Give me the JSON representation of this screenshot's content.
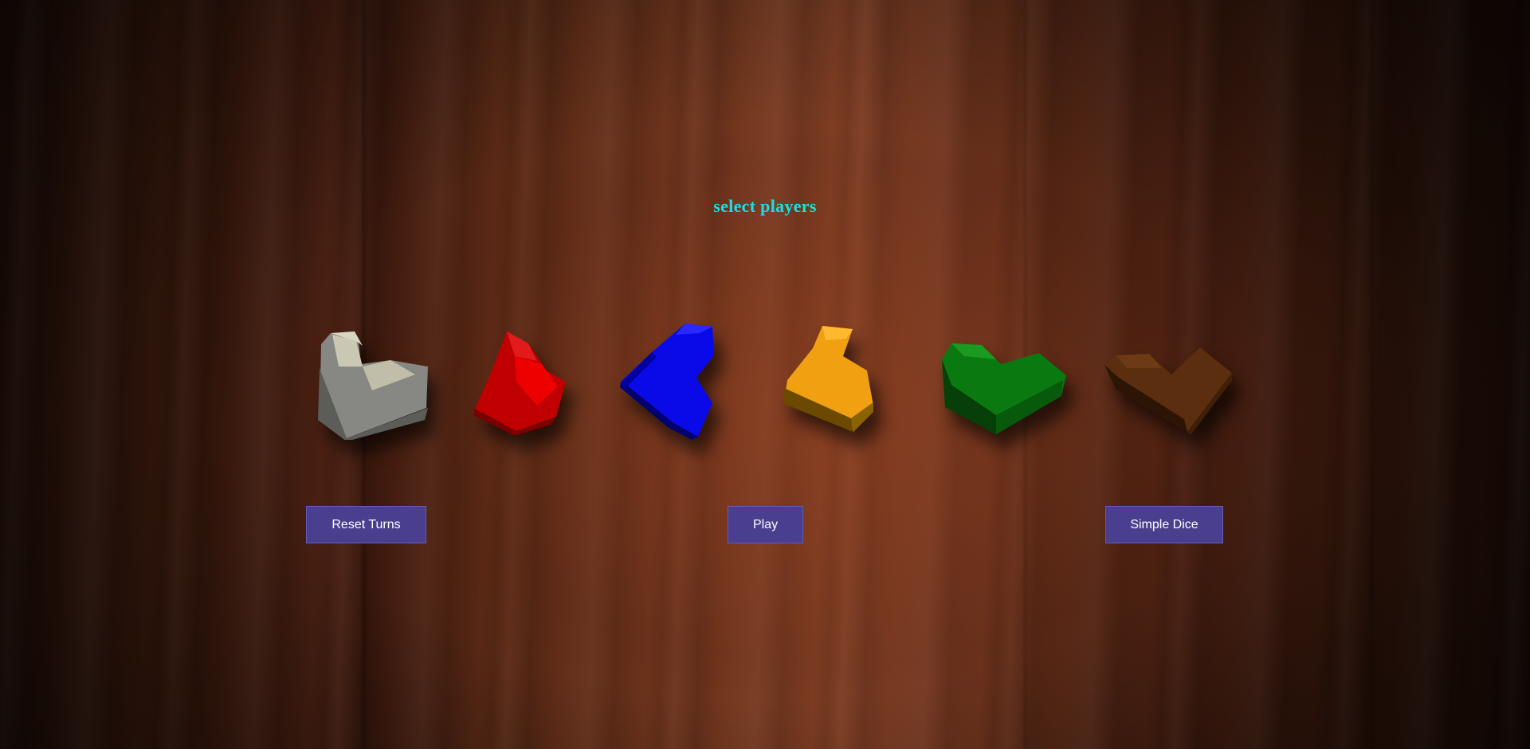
{
  "title": "select players",
  "pieces": [
    {
      "name": "player-piece-white",
      "color": "#c8c6b2"
    },
    {
      "name": "player-piece-red",
      "color": "#e00000"
    },
    {
      "name": "player-piece-blue",
      "color": "#0a0af0"
    },
    {
      "name": "player-piece-orange",
      "color": "#f0a010"
    },
    {
      "name": "player-piece-green",
      "color": "#0a7a10"
    },
    {
      "name": "player-piece-brown",
      "color": "#5a2e0e"
    }
  ],
  "buttons": {
    "reset_label": "Reset Turns",
    "play_label": "Play",
    "dice_label": "Simple Dice"
  },
  "colors": {
    "title": "#19e0e0",
    "button_bg": "#4a3f8f",
    "button_text": "#ffffff"
  }
}
